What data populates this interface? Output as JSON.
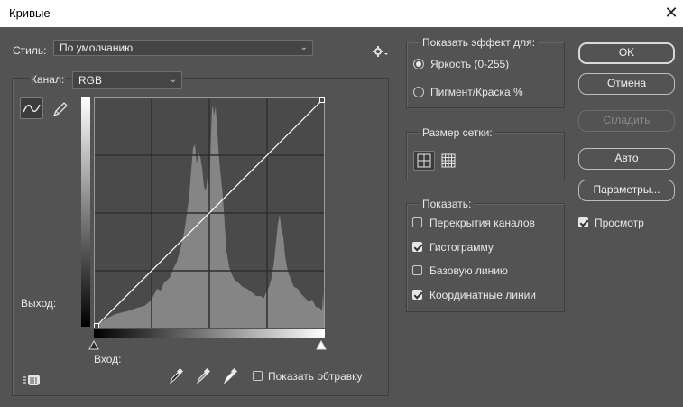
{
  "window": {
    "title": "Кривые",
    "close_glyph": "✕"
  },
  "preset": {
    "label": "Стиль:",
    "value": "По умолчанию"
  },
  "channel": {
    "label": "Канал:",
    "value": "RGB"
  },
  "axes": {
    "output_label": "Выход:",
    "input_label": "Вход:"
  },
  "show_clipping": {
    "label": "Показать обтравку",
    "checked": false
  },
  "show_amount": {
    "legend": "Показать эффект для:",
    "options": [
      {
        "label": "Яркость (0-255)",
        "selected": true
      },
      {
        "label": "Пигмент/Краска %",
        "selected": false
      }
    ]
  },
  "grid_size": {
    "legend": "Размер сетки:"
  },
  "display": {
    "legend": "Показать:",
    "options": [
      {
        "label": "Перекрытия каналов",
        "checked": false
      },
      {
        "label": "Гистограмму",
        "checked": true
      },
      {
        "label": "Базовую линию",
        "checked": false
      },
      {
        "label": "Координатные линии",
        "checked": true
      }
    ]
  },
  "buttons": {
    "ok": "OK",
    "cancel": "Отмена",
    "smooth": "Сгладить",
    "auto": "Авто",
    "options": "Параметры..."
  },
  "preview": {
    "label": "Просмотр",
    "checked": true
  },
  "colors": {
    "accent_line": "#ffffff",
    "histogram": "#858585",
    "graph_bg": "#4a4a4a"
  }
}
